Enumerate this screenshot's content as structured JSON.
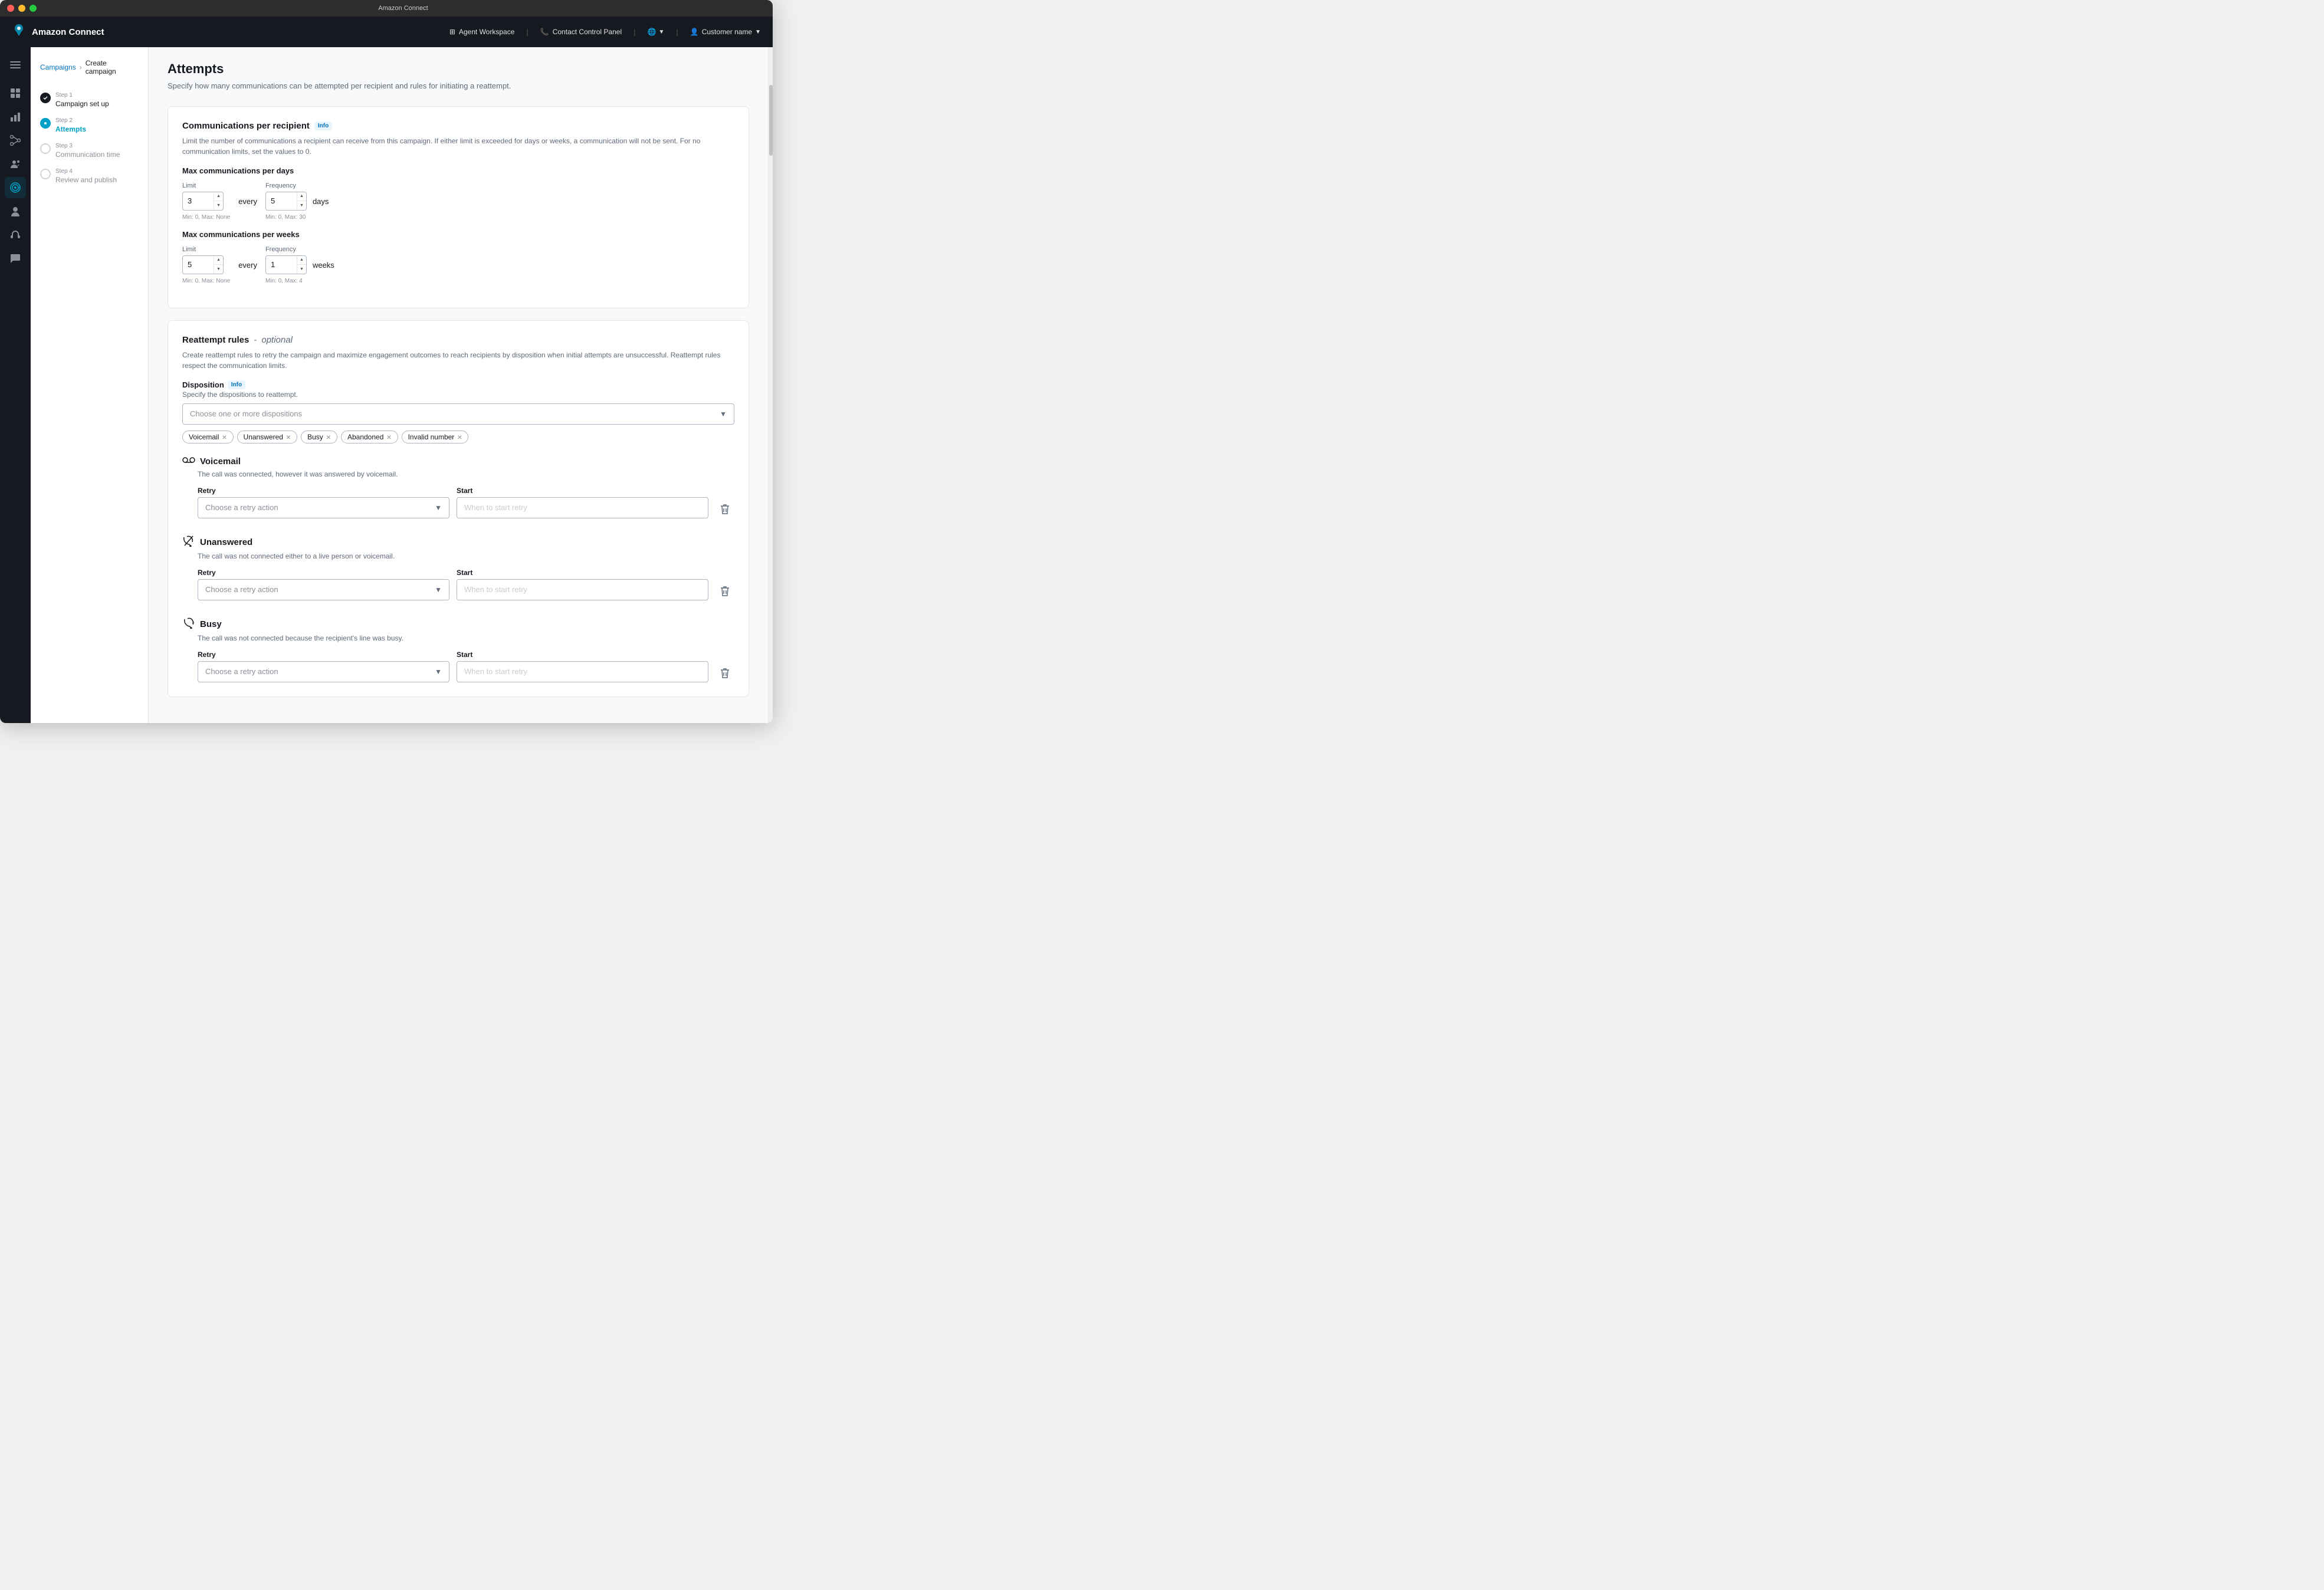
{
  "window": {
    "title": "Amazon Connect"
  },
  "topnav": {
    "brand": "Amazon Connect",
    "agent_workspace": "Agent Workspace",
    "contact_control_panel": "Contact Control Panel",
    "customer_name": "Customer name"
  },
  "breadcrumb": {
    "campaigns": "Campaigns",
    "current": "Create campaign"
  },
  "steps": [
    {
      "label": "Step 1",
      "name": "Campaign set up",
      "state": "completed"
    },
    {
      "label": "Step 2",
      "name": "Attempts",
      "state": "active"
    },
    {
      "label": "Step 3",
      "name": "Communication time",
      "state": "pending"
    },
    {
      "label": "Step 4",
      "name": "Review and publish",
      "state": "pending"
    }
  ],
  "page": {
    "title": "Attempts",
    "description": "Specify how many communications can be attempted per recipient and rules for initiating a reattempt."
  },
  "comms_per_recipient": {
    "title": "Communications per recipient",
    "info_label": "Info",
    "description": "Limit the number of communications a recipient can receive from this campaign. If either limit is exceeded for days or weeks, a communication will not be sent. For no communication limits, set the values to 0.",
    "max_per_days_title": "Max communications per days",
    "limit_label": "Limit",
    "frequency_label": "Frequency",
    "limit_days_value": "3",
    "frequency_days_value": "5",
    "every_text": "every",
    "days_unit": "days",
    "limit_days_hint": "Min: 0, Max: None",
    "frequency_days_hint": "Min: 0, Max: 30",
    "max_per_weeks_title": "Max communications per weeks",
    "limit_weeks_value": "5",
    "frequency_weeks_value": "1",
    "weeks_unit": "weeks",
    "limit_weeks_hint": "Min: 0, Max: None",
    "frequency_weeks_hint": "Min: 0, Max: 4"
  },
  "reattempt_rules": {
    "title": "Reattempt rules",
    "optional_label": "optional",
    "description": "Create reattempt rules to retry the campaign and maximize engagement outcomes to reach recipients by disposition when initial attempts are unsuccessful. Reattempt rules respect the communication limits.",
    "disposition_label": "Disposition",
    "info_label": "Info",
    "disposition_desc": "Specify the dispositions to reattempt.",
    "disposition_placeholder": "Choose one or more dispositions",
    "tags": [
      "Voicemail",
      "Unanswered",
      "Busy",
      "Abandoned",
      "Invalid number"
    ],
    "disposition_groups": [
      {
        "icon": "📞",
        "title": "Voicemail",
        "icon_type": "voicemail",
        "description": "The call was connected, however it was answered by voicemail.",
        "retry_label": "Retry",
        "start_label": "Start",
        "retry_placeholder": "Choose a retry action",
        "start_placeholder": "When to start retry"
      },
      {
        "icon": "📞",
        "title": "Unanswered",
        "icon_type": "unanswered",
        "description": "The call was not connected either to a live person or voicemail.",
        "retry_label": "Retry",
        "start_label": "Start",
        "retry_placeholder": "Choose a retry action",
        "start_placeholder": "When to start retry"
      },
      {
        "icon": "📞",
        "title": "Busy",
        "icon_type": "busy",
        "description": "The call was not connected because the recipient's line was busy.",
        "retry_label": "Retry",
        "start_label": "Start",
        "retry_placeholder": "Choose a retry action",
        "start_placeholder": "When to start retry"
      }
    ]
  },
  "sidebar": {
    "items": [
      {
        "icon": "☰",
        "name": "menu",
        "label": "Menu"
      },
      {
        "icon": "⊞",
        "name": "dashboard",
        "label": "Dashboard"
      },
      {
        "icon": "📊",
        "name": "analytics",
        "label": "Analytics"
      },
      {
        "icon": "⚡",
        "name": "flows",
        "label": "Flows"
      },
      {
        "icon": "👥",
        "name": "users",
        "label": "Users"
      },
      {
        "icon": "📋",
        "name": "campaigns",
        "label": "Campaigns",
        "active": true
      },
      {
        "icon": "👤",
        "name": "profile",
        "label": "Profile"
      },
      {
        "icon": "🎧",
        "name": "headset",
        "label": "Headset"
      },
      {
        "icon": "💬",
        "name": "chat",
        "label": "Chat"
      }
    ]
  }
}
